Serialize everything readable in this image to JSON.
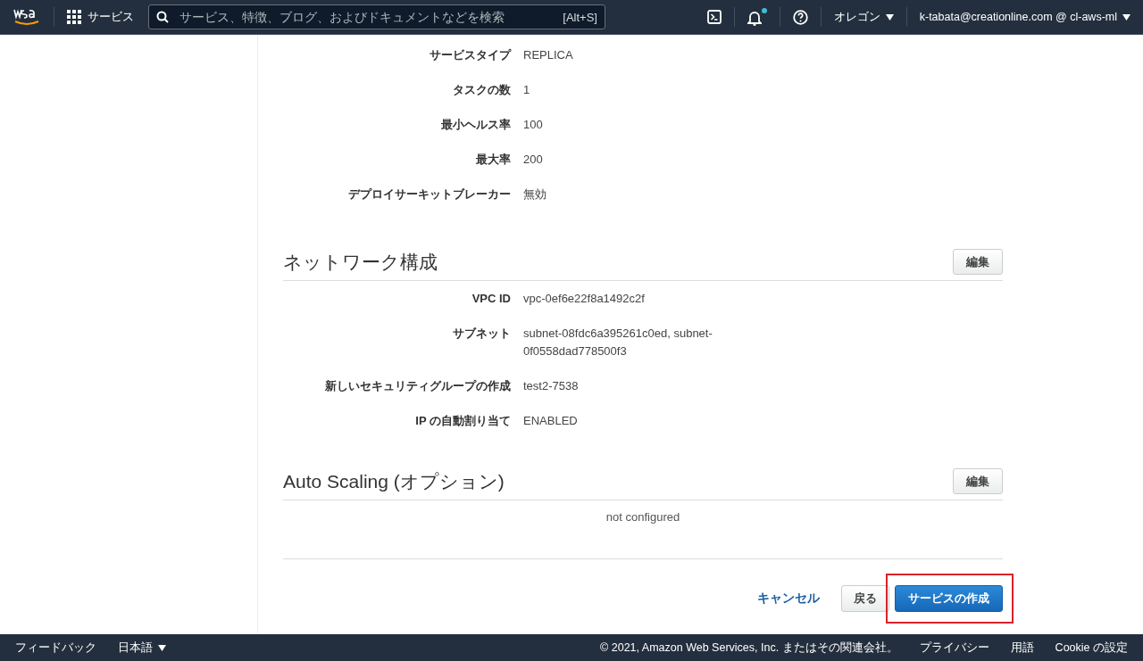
{
  "top_bar": {
    "services_label": "サービス",
    "search": {
      "placeholder": "サービス、特徴、ブログ、およびドキュメントなどを検索",
      "shortcut": "[Alt+S]"
    },
    "notification_badge": true,
    "region": "オレゴン",
    "account": "k-tabata@creationline.com @ cl-aws-ml"
  },
  "service_details": [
    {
      "label": "サービスタイプ",
      "value": "REPLICA"
    },
    {
      "label": "タスクの数",
      "value": "1"
    },
    {
      "label": "最小ヘルス率",
      "value": "100"
    },
    {
      "label": "最大率",
      "value": "200"
    },
    {
      "label": "デプロイサーキットブレーカー",
      "value": "無効"
    }
  ],
  "network": {
    "title": "ネットワーク構成",
    "edit": "編集",
    "rows": [
      {
        "label": "VPC ID",
        "value": "vpc-0ef6e22f8a1492c2f"
      },
      {
        "label": "サブネット",
        "value": "subnet-08fdc6a395261c0ed, subnet-0f0558dad778500f3"
      },
      {
        "label": "新しいセキュリティグループの作成",
        "value": "test2-7538"
      },
      {
        "label": "IP の自動割り当て",
        "value": "ENABLED"
      }
    ]
  },
  "auto_scaling": {
    "title": "Auto Scaling (オプション)",
    "edit": "編集",
    "message": "not configured"
  },
  "actions": {
    "cancel": "キャンセル",
    "back": "戻る",
    "create": "サービスの作成",
    "create_highlighted": true
  },
  "footer": {
    "feedback": "フィードバック",
    "language": "日本語",
    "copyright": "© 2021, Amazon Web Services, Inc. またはその関連会社。",
    "links": [
      "プライバシー",
      "用語",
      "Cookie の設定"
    ]
  }
}
